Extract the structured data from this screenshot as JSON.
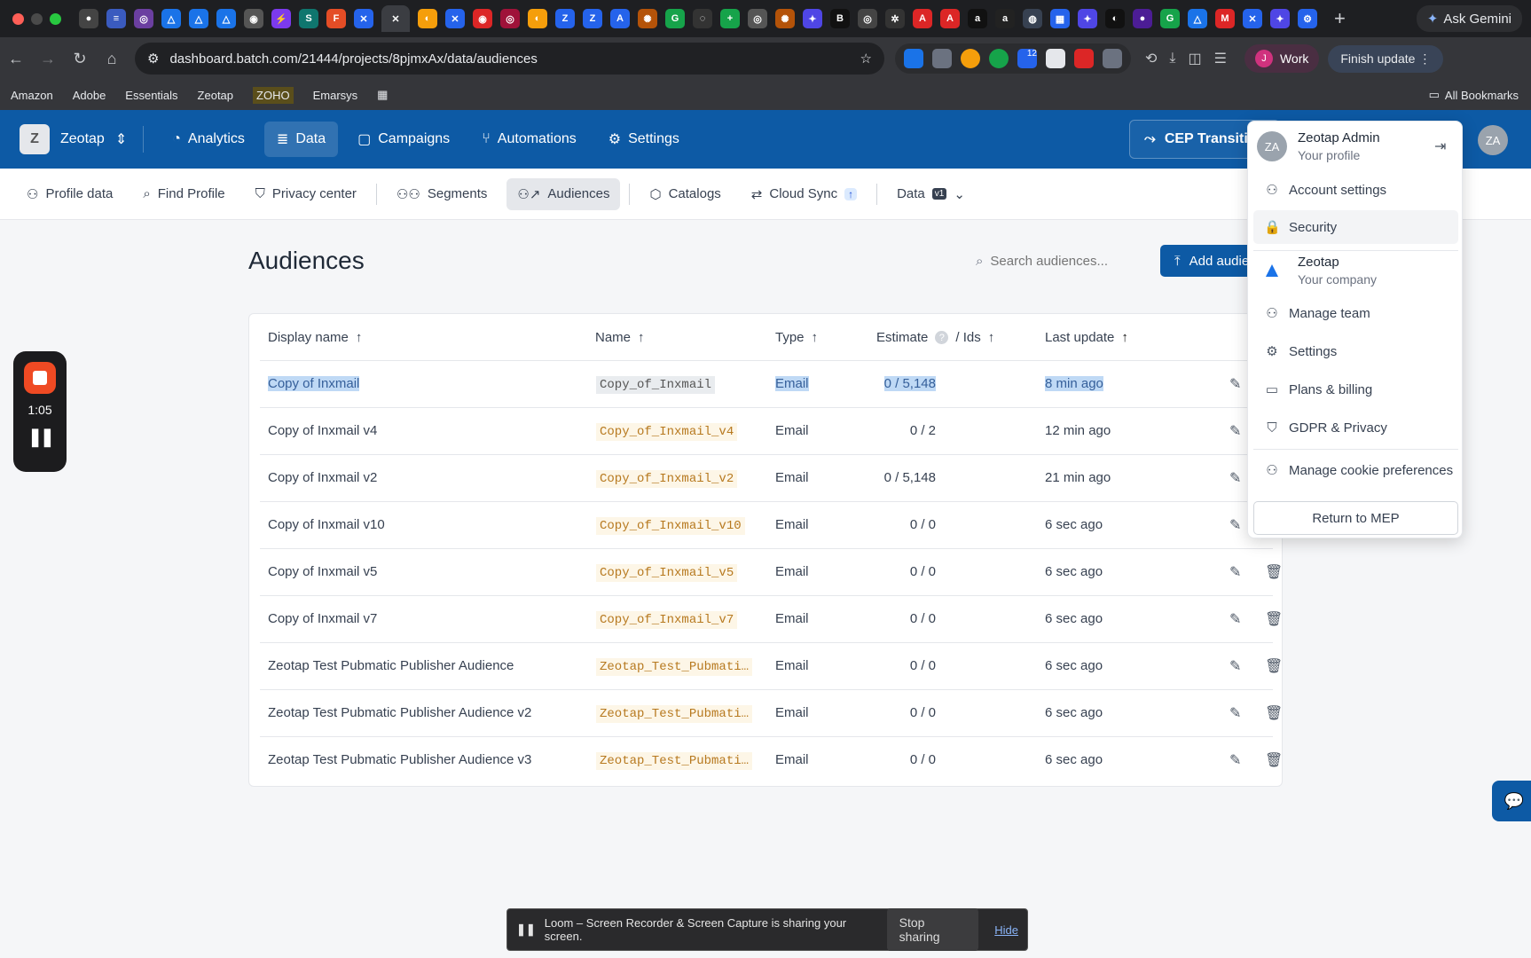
{
  "browser": {
    "url": "dashboard.batch.com/21444/projects/8pjmxAx/data/audiences",
    "ask_gemini": "Ask Gemini",
    "profile_label": "Work",
    "profile_initial": "J",
    "finish_update": "Finish update",
    "ext_badge": "12",
    "bookmarks": [
      "Amazon",
      "Adobe",
      "Essentials",
      "Zeotap",
      "ZOHO",
      "Emarsys"
    ],
    "all_bookmarks": "All Bookmarks"
  },
  "appnav": {
    "org_initial": "Z",
    "org_name": "Zeotap",
    "items": [
      "Analytics",
      "Data",
      "Campaigns",
      "Automations",
      "Settings"
    ],
    "cep_button": "CEP Transition",
    "avatar": "ZA",
    "accent": "#0d5aa5"
  },
  "subnav": {
    "items": [
      "Profile data",
      "Find Profile",
      "Privacy center",
      "Segments",
      "Audiences",
      "Catalogs",
      "Cloud Sync"
    ],
    "data_label": "Data",
    "data_badge": "v1"
  },
  "page": {
    "title": "Audiences",
    "search_placeholder": "Search audiences...",
    "add_button": "Add audience"
  },
  "table": {
    "headers": [
      "Display name",
      "Name",
      "Type",
      "Estimate",
      "/ Ids",
      "Last update"
    ],
    "rows": [
      {
        "display": "Copy of Inxmail",
        "name": "Copy_of_Inxmail",
        "type": "Email",
        "estimate": "0 / 5,148",
        "updated": "8 min ago"
      },
      {
        "display": "Copy of Inxmail v4",
        "name": "Copy_of_Inxmail_v4",
        "type": "Email",
        "estimate": "0 / 2",
        "updated": "12 min ago"
      },
      {
        "display": "Copy of Inxmail v2",
        "name": "Copy_of_Inxmail_v2",
        "type": "Email",
        "estimate": "0 / 5,148",
        "updated": "21 min ago"
      },
      {
        "display": "Copy of Inxmail v10",
        "name": "Copy_of_Inxmail_v10",
        "type": "Email",
        "estimate": "0 / 0",
        "updated": "6 sec ago"
      },
      {
        "display": "Copy of Inxmail v5",
        "name": "Copy_of_Inxmail_v5",
        "type": "Email",
        "estimate": "0 / 0",
        "updated": "6 sec ago"
      },
      {
        "display": "Copy of Inxmail v7",
        "name": "Copy_of_Inxmail_v7",
        "type": "Email",
        "estimate": "0 / 0",
        "updated": "6 sec ago"
      },
      {
        "display": "Zeotap Test Pubmatic Publisher Audience",
        "name": "Zeotap_Test_Pubmati…",
        "type": "Email",
        "estimate": "0 / 0",
        "updated": "6 sec ago"
      },
      {
        "display": "Zeotap Test Pubmatic Publisher Audience v2",
        "name": "Zeotap_Test_Pubmati…",
        "type": "Email",
        "estimate": "0 / 0",
        "updated": "6 sec ago"
      },
      {
        "display": "Zeotap Test Pubmatic Publisher Audience v3",
        "name": "Zeotap_Test_Pubmati…",
        "type": "Email",
        "estimate": "0 / 0",
        "updated": "6 sec ago"
      }
    ]
  },
  "recorder": {
    "time": "1:05"
  },
  "dropdown": {
    "user_name": "Zeotap Admin",
    "user_sub": "Your profile",
    "account_settings": "Account settings",
    "security": "Security",
    "company_name": "Zeotap",
    "company_sub": "Your company",
    "manage_team": "Manage team",
    "settings": "Settings",
    "plans": "Plans & billing",
    "gdpr": "GDPR & Privacy",
    "cookies": "Manage cookie preferences",
    "return": "Return to MEP"
  },
  "loom": {
    "message": "Loom – Screen Recorder & Screen Capture is sharing your screen.",
    "stop": "Stop sharing",
    "hide": "Hide"
  }
}
